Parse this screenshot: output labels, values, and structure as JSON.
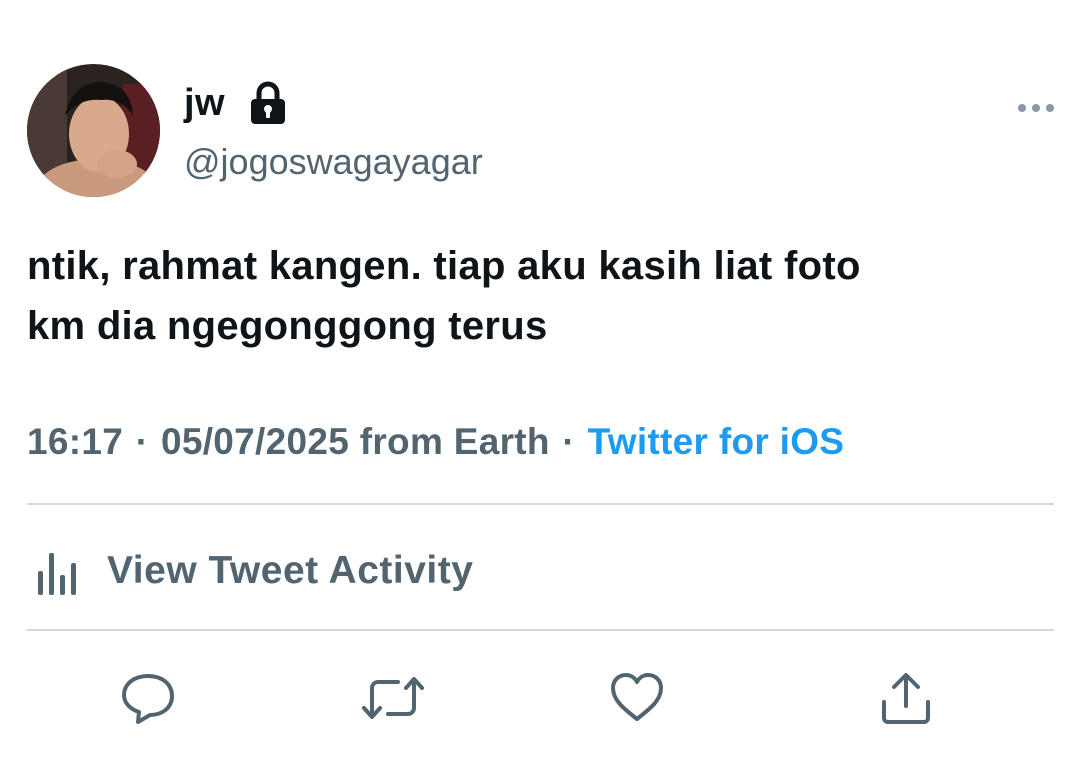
{
  "tweet": {
    "author": {
      "display_name": "jw",
      "handle": "@jogoswagayagar",
      "protected": true
    },
    "text_lines": [
      "ntik, rahmat kangen. tiap aku kasih liat foto",
      "km dia ngegonggong terus"
    ],
    "time": "16:17",
    "date": "05/07/2025",
    "location": "from Earth",
    "separator": "·",
    "source": "Twitter for iOS",
    "activity_label": "View Tweet Activity"
  },
  "actions": [
    {
      "name": "reply",
      "icon": "reply-icon"
    },
    {
      "name": "retweet",
      "icon": "retweet-icon"
    },
    {
      "name": "like",
      "icon": "heart-icon"
    },
    {
      "name": "share",
      "icon": "share-icon"
    }
  ],
  "colors": {
    "text_primary": "#0f1419",
    "text_secondary": "#536471",
    "link": "#1d9bf0",
    "divider": "#cfd9de"
  }
}
